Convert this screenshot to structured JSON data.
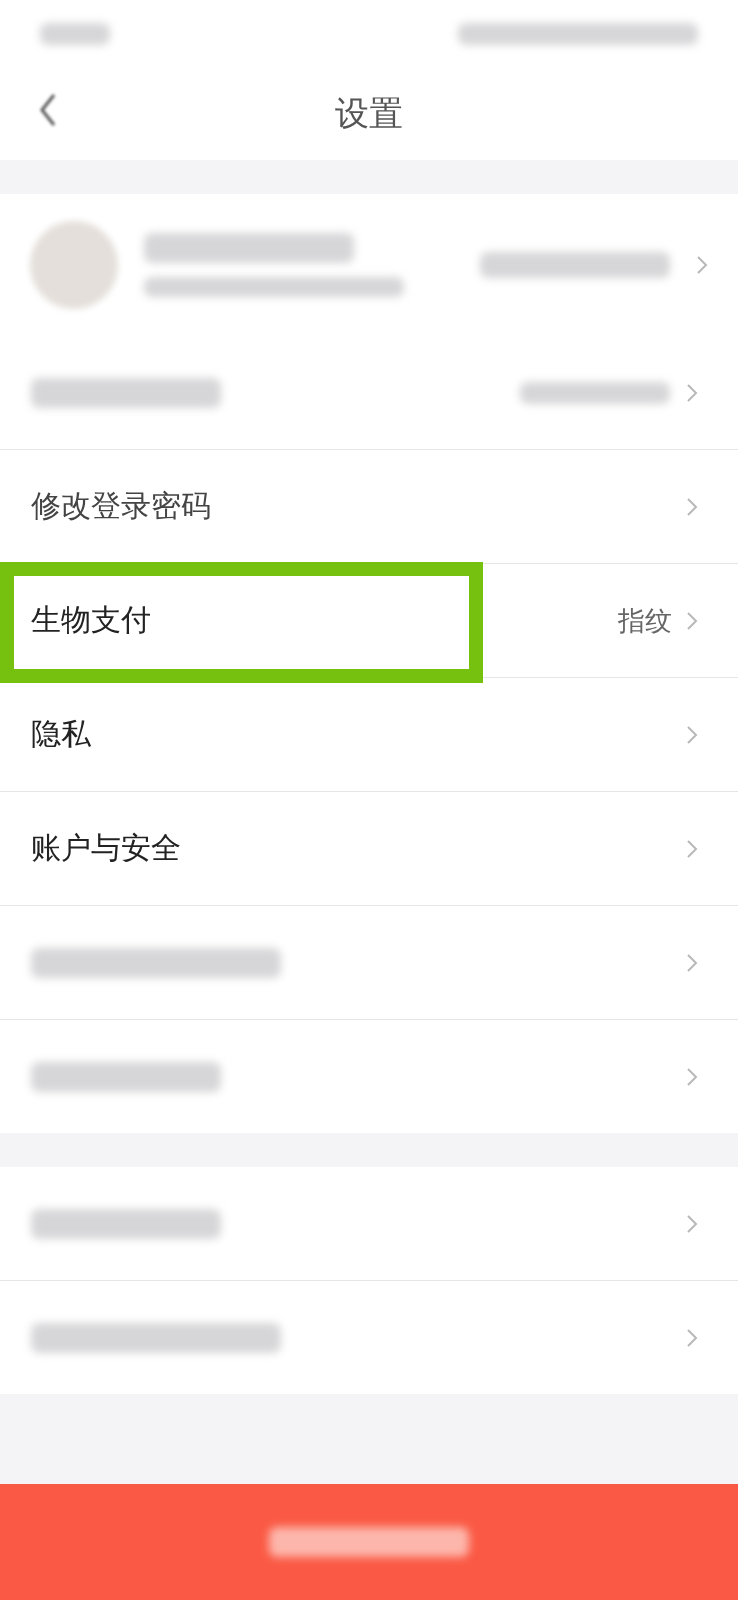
{
  "header": {
    "title": "设置"
  },
  "groups": [
    {
      "kind": "profile"
    },
    {
      "kind": "list",
      "rows": [
        {
          "kind": "redacted_pair"
        },
        {
          "kind": "blurred",
          "label": "修改登录密码"
        },
        {
          "kind": "text",
          "label": "生物支付",
          "value": "指纹",
          "highlighted": true
        },
        {
          "kind": "text",
          "label": "隐私",
          "highlighted": false
        },
        {
          "kind": "text",
          "label": "账户与安全",
          "highlighted": false
        },
        {
          "kind": "redacted"
        },
        {
          "kind": "redacted"
        }
      ]
    },
    {
      "kind": "list",
      "rows": [
        {
          "kind": "redacted"
        },
        {
          "kind": "redacted"
        }
      ]
    }
  ],
  "logout": {
    "kind": "redacted"
  }
}
